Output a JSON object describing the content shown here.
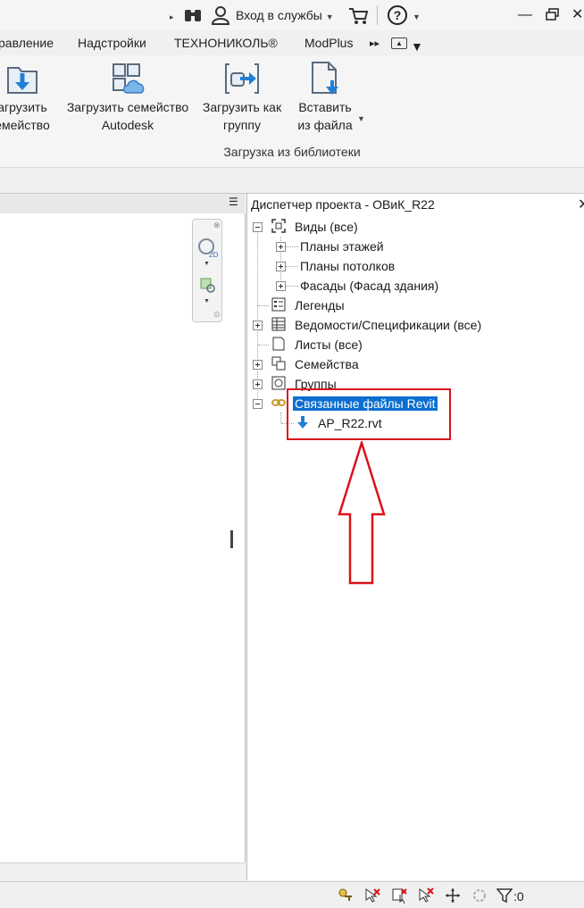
{
  "titlebar": {
    "signin_label": "Вход в службы",
    "icons": [
      "binoculars-icon",
      "user-icon",
      "cart-icon",
      "help-icon"
    ]
  },
  "tabs": [
    "равление",
    "Надстройки",
    "ТЕХНОНИКОЛЬ®",
    "ModPlus"
  ],
  "ribbon": {
    "buttons": [
      {
        "label": "агрузить\nемейство",
        "icon": "load-family-icon"
      },
      {
        "label": "Загрузить семейство\nAutodesk",
        "icon": "load-autodesk-family-icon"
      },
      {
        "label": "Загрузить как\nгруппу",
        "icon": "load-as-group-icon"
      },
      {
        "label": "Вставить\nиз файла",
        "icon": "insert-from-file-icon"
      }
    ],
    "panel_title": "Загрузка из библиотеки"
  },
  "browser": {
    "title": "Диспетчер проекта - ОВиК_R22",
    "close_label": "✕",
    "tree": [
      {
        "label": "Виды (все)",
        "expanded": true
      },
      {
        "label": "Планы этажей"
      },
      {
        "label": "Планы потолков"
      },
      {
        "label": "Фасады (Фасад здания)"
      },
      {
        "label": "Легенды"
      },
      {
        "label": "Ведомости/Спецификации (все)"
      },
      {
        "label": "Листы (все)"
      },
      {
        "label": "Семейства"
      },
      {
        "label": "Группы"
      },
      {
        "label": "Связанные файлы Revit",
        "selected": true
      },
      {
        "label": "АР_R22.rvt"
      }
    ]
  },
  "statusbar": {
    "filter_count": ":0"
  },
  "colors": {
    "selection": "#0c6fd0",
    "highlight": "#d9121b"
  }
}
